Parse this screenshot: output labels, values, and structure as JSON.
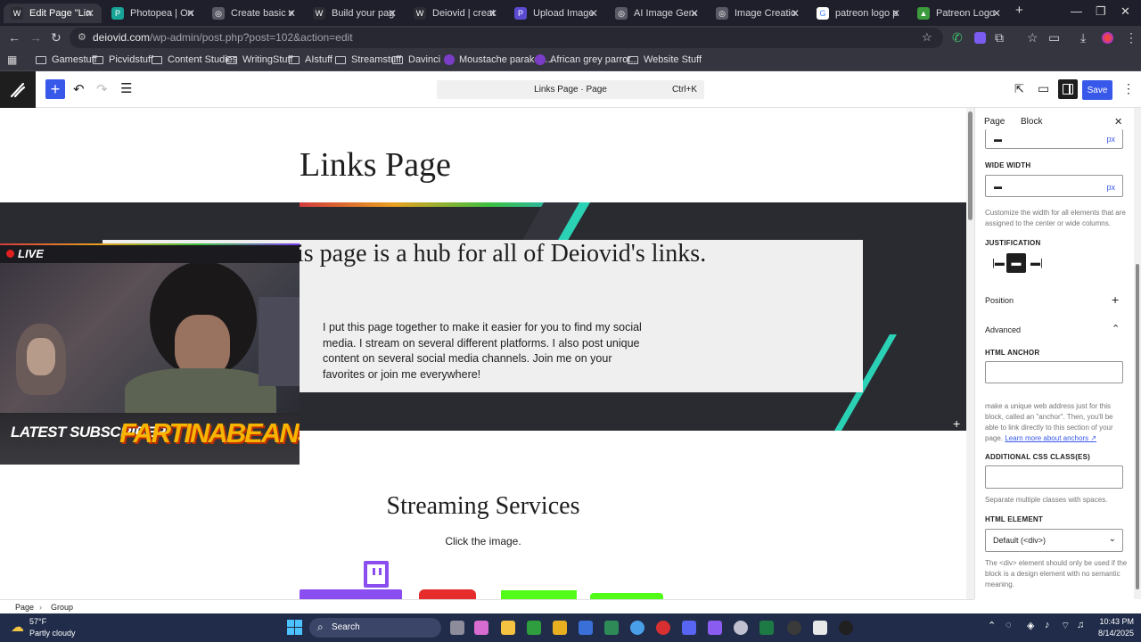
{
  "browser": {
    "tabs": [
      {
        "label": "Edit Page \"Links Pa",
        "color": "#2c2c35",
        "glyph": "W"
      },
      {
        "label": "Photopea | Online",
        "color": "#18a497",
        "glyph": "P"
      },
      {
        "label": "Create basic websi",
        "color": "#5a5a66",
        "glyph": "◎"
      },
      {
        "label": "Build your page | I",
        "color": "#2c2c35",
        "glyph": "W"
      },
      {
        "label": "Deiovid | creating",
        "color": "#2c2c35",
        "glyph": "W"
      },
      {
        "label": "Upload Image Onl",
        "color": "#5a4bd1",
        "glyph": "P"
      },
      {
        "label": "AI Image Generat",
        "color": "#5a5a66",
        "glyph": "◎"
      },
      {
        "label": "Image Creation - I",
        "color": "#5a5a66",
        "glyph": "◎"
      },
      {
        "label": "patreon logo png",
        "color": "#ffffff",
        "glyph": "G"
      },
      {
        "label": "Patreon Logo - Pa",
        "color": "#3c9b3c",
        "glyph": "▲"
      }
    ],
    "url_host": "deiovid.com",
    "url_path": "/wp-admin/post.php?post=102&action=edit",
    "bookmarks": [
      {
        "label": "Gamestuff",
        "type": "folder"
      },
      {
        "label": "Picvidstuff",
        "type": "folder"
      },
      {
        "label": "Content Studies",
        "type": "folder"
      },
      {
        "label": "WritingStuff",
        "type": "folder"
      },
      {
        "label": "AIstuff",
        "type": "folder"
      },
      {
        "label": "Streamstuff",
        "type": "folder"
      },
      {
        "label": "Davinci",
        "type": "folder"
      },
      {
        "label": "Moustache parakee...",
        "type": "site"
      },
      {
        "label": "African grey parrot...",
        "type": "site"
      },
      {
        "label": "Website Stuff",
        "type": "folder"
      }
    ]
  },
  "editor": {
    "command_bar_title": "Links Page · Page",
    "command_bar_shortcut": "Ctrl+K",
    "save_label": "Save"
  },
  "content": {
    "hero_title": "Links Page",
    "hero_subtitle": "is page is a hub for all of Deiovid's links.",
    "hero_body": "I put this page together to make it easier for you to find my social media. I stream on several different platforms. I also post unique content on several social media channels. Join me on your favorites or join me everywhere!",
    "streaming_title": "Streaming Services",
    "streaming_hint": "Click the image."
  },
  "overlay": {
    "live_label": "LIVE",
    "latest_subscriber_label": "LATEST SUBSCRIBER",
    "subscriber_name": "FARTINABEANSALO"
  },
  "sidebar": {
    "tab_page": "Page",
    "tab_block": "Block",
    "wide_width_label": "WIDE WIDTH",
    "unit_px": "px",
    "width_help": "Customize the width for all elements that are assigned to the center or wide columns.",
    "justification_label": "JUSTIFICATION",
    "position_label": "Position",
    "advanced_label": "Advanced",
    "html_anchor_label": "HTML ANCHOR",
    "anchor_help_prefix": "make a unique web address just for this block, called an \"anchor\". Then, you'll be able to link directly to this section of your page.",
    "anchor_help_link": "Learn more about anchors ↗",
    "css_class_label": "ADDITIONAL CSS CLASS(ES)",
    "css_class_help": "Separate multiple classes with spaces.",
    "html_element_label": "HTML ELEMENT",
    "html_element_value": "Default (<div>)",
    "html_element_help": "The <div> element should only be used if the block is a design element with no semantic meaning."
  },
  "breadcrumb": {
    "items": [
      "Page",
      "Group"
    ]
  },
  "taskbar": {
    "weather_temp": "57°F",
    "weather_desc": "Partly cloudy",
    "search_label": "Search",
    "time": "10:43 PM",
    "date": "8/14/2025"
  },
  "colors": {
    "wp_blue": "#3858e9",
    "hero_dark": "#2a2b31",
    "accent_teal": "#2ad1b5",
    "twitch_purple": "#8a4df0",
    "kick_green": "#53fc18"
  }
}
